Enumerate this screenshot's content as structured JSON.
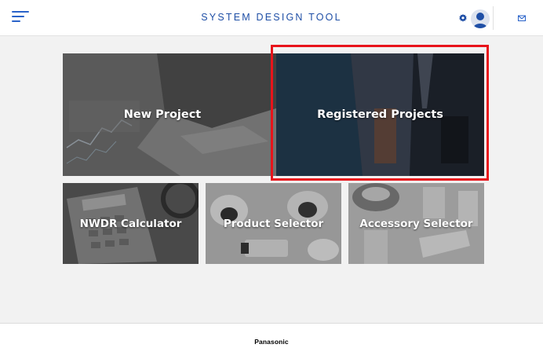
{
  "header": {
    "title": "SYSTEM DESIGN TOOL",
    "icons": {
      "menu": "hamburger-menu-icon",
      "settings": "gear-icon",
      "account": "user-avatar-icon",
      "mail": "mail-icon"
    }
  },
  "tiles": [
    {
      "label": "New Project",
      "image": "laptop-charts"
    },
    {
      "label": "Registered Projects",
      "image": "business-people",
      "highlighted": true
    },
    {
      "label": "NWDR Calculator",
      "image": "calculator-magnifier"
    },
    {
      "label": "Product Selector",
      "image": "security-cameras"
    },
    {
      "label": "Accessory Selector",
      "image": "camera-mounts"
    }
  ],
  "footer": {
    "brand": "Panasonic"
  },
  "colors": {
    "accent": "#2a63c9",
    "title": "#1f4fa6",
    "highlight": "#e8141b",
    "background": "#f2f2f2"
  }
}
